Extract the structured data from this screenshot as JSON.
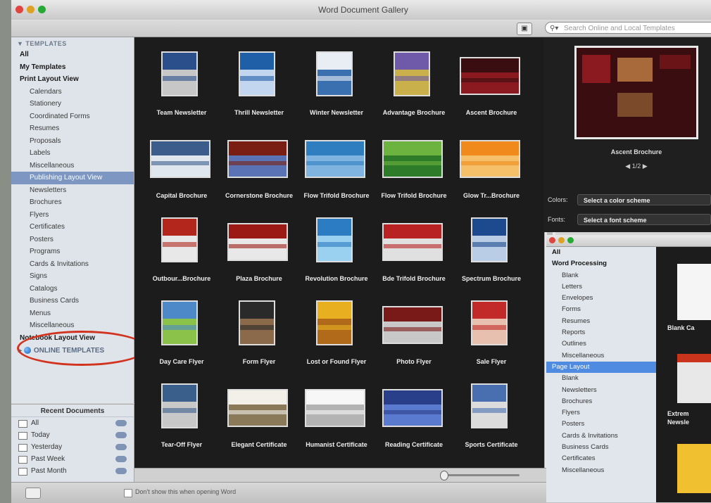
{
  "window": {
    "title": "Word Document Gallery"
  },
  "search": {
    "placeholder": "Search Online and Local Templates"
  },
  "sidebar": {
    "header": "TEMPLATES",
    "items": [
      {
        "label": "All",
        "style": "bold"
      },
      {
        "label": "My Templates",
        "style": "bold"
      },
      {
        "label": "Print Layout View",
        "style": "bold"
      },
      {
        "label": "Calendars",
        "style": "sub"
      },
      {
        "label": "Stationery",
        "style": "sub"
      },
      {
        "label": "Coordinated Forms",
        "style": "sub"
      },
      {
        "label": "Resumes",
        "style": "sub"
      },
      {
        "label": "Proposals",
        "style": "sub"
      },
      {
        "label": "Labels",
        "style": "sub"
      },
      {
        "label": "Miscellaneous",
        "style": "sub"
      },
      {
        "label": "Publishing Layout View",
        "style": "sel"
      },
      {
        "label": "Newsletters",
        "style": "sub"
      },
      {
        "label": "Brochures",
        "style": "sub"
      },
      {
        "label": "Flyers",
        "style": "sub"
      },
      {
        "label": "Certificates",
        "style": "sub"
      },
      {
        "label": "Posters",
        "style": "sub"
      },
      {
        "label": "Programs",
        "style": "sub"
      },
      {
        "label": "Cards & Invitations",
        "style": "sub"
      },
      {
        "label": "Signs",
        "style": "sub"
      },
      {
        "label": "Catalogs",
        "style": "sub"
      },
      {
        "label": "Business Cards",
        "style": "sub"
      },
      {
        "label": "Menus",
        "style": "sub"
      },
      {
        "label": "Miscellaneous",
        "style": "sub"
      },
      {
        "label": "Notebook Layout View",
        "style": "bold"
      }
    ],
    "online": "ONLINE TEMPLATES"
  },
  "recent": {
    "header": "Recent Documents",
    "items": [
      "All",
      "Today",
      "Yesterday",
      "Past Week",
      "Past Month"
    ]
  },
  "gallery": {
    "templates": [
      {
        "label": "Team Newsletter",
        "c1": "#2a4f8a",
        "c2": "#c7c7c7",
        "wide": false
      },
      {
        "label": "Thrill Newsletter",
        "c1": "#1f5fa8",
        "c2": "#c2d6ef",
        "wide": false
      },
      {
        "label": "Winter Newsletter",
        "c1": "#e9eef5",
        "c2": "#3a6fb0",
        "wide": false
      },
      {
        "label": "Advantage Brochure",
        "c1": "#6e5aa8",
        "c2": "#c9b04a",
        "wide": false
      },
      {
        "label": "Ascent Brochure",
        "c1": "#3a0d10",
        "c2": "#8a1a20",
        "wide": true
      },
      {
        "label": "Capital Brochure",
        "c1": "#3c5d8c",
        "c2": "#dfe6ee",
        "wide": true
      },
      {
        "label": "Cornerstone Brochure",
        "c1": "#7a1e14",
        "c2": "#5a73b5",
        "wide": true
      },
      {
        "label": "Flow Trifold Brochure",
        "c1": "#2f7ec0",
        "c2": "#7fb4e0",
        "wide": true
      },
      {
        "label": "Flow Trifold Brochure",
        "c1": "#6cb33f",
        "c2": "#2e7b2a",
        "wide": true
      },
      {
        "label": "Glow Tr...Brochure",
        "c1": "#f08a1c",
        "c2": "#f6c06a",
        "wide": true
      },
      {
        "label": "Outbour...Brochure",
        "c1": "#b2261c",
        "c2": "#e8e8e8",
        "wide": false
      },
      {
        "label": "Plaza Brochure",
        "c1": "#9c1a16",
        "c2": "#e8e8e8",
        "wide": true
      },
      {
        "label": "Revolution Brochure",
        "c1": "#2b7cc2",
        "c2": "#9ad0f0",
        "wide": false
      },
      {
        "label": "Bde Trifold Brochure",
        "c1": "#b82222",
        "c2": "#e0e0e0",
        "wide": true
      },
      {
        "label": "Spectrum Brochure",
        "c1": "#1d4a8e",
        "c2": "#b9cde6",
        "wide": false
      },
      {
        "label": "Day Care Flyer",
        "c1": "#4d89c8",
        "c2": "#8bc34a",
        "wide": false
      },
      {
        "label": "Form Flyer",
        "c1": "#2a2a2a",
        "c2": "#8a6a4a",
        "wide": false
      },
      {
        "label": "Lost or Found Flyer",
        "c1": "#e8b020",
        "c2": "#b06a1a",
        "wide": false
      },
      {
        "label": "Photo Flyer",
        "c1": "#7a1a18",
        "c2": "#c8c8c8",
        "wide": true
      },
      {
        "label": "Sale Flyer",
        "c1": "#c22a2a",
        "c2": "#e8c0b0",
        "wide": false
      },
      {
        "label": "Tear-Off Flyer",
        "c1": "#3a5f8a",
        "c2": "#c8c8c8",
        "wide": false
      },
      {
        "label": "Elegant Certificate",
        "c1": "#f2f0e8",
        "c2": "#8a7a5a",
        "wide": true
      },
      {
        "label": "Humanist Certificate",
        "c1": "#f7f7f7",
        "c2": "#b3b3b3",
        "wide": true
      },
      {
        "label": "Reading Certificate",
        "c1": "#2a3f8a",
        "c2": "#5a7ad0",
        "wide": true
      },
      {
        "label": "Sports Certificate",
        "c1": "#4a6fb0",
        "c2": "#dcdcdc",
        "wide": false
      }
    ]
  },
  "preview": {
    "caption": "Ascent Brochure",
    "page": "1/2",
    "colors_label": "Colors:",
    "colors_value": "Select a color scheme",
    "fonts_label": "Fonts:",
    "fonts_value": "Select a font scheme"
  },
  "bottom": {
    "checkbox_label": "Don't show this when opening Word"
  },
  "second_window": {
    "items": [
      {
        "label": "All",
        "style": "bold"
      },
      {
        "label": "Word Processing",
        "style": "bold"
      },
      {
        "label": "Blank",
        "style": "sub"
      },
      {
        "label": "Letters",
        "style": "sub"
      },
      {
        "label": "Envelopes",
        "style": "sub"
      },
      {
        "label": "Forms",
        "style": "sub"
      },
      {
        "label": "Resumes",
        "style": "sub"
      },
      {
        "label": "Reports",
        "style": "sub"
      },
      {
        "label": "Outlines",
        "style": "sub"
      },
      {
        "label": "Miscellaneous",
        "style": "sub"
      },
      {
        "label": "Page Layout",
        "style": "sel"
      },
      {
        "label": "Blank",
        "style": "sub"
      },
      {
        "label": "Newsletters",
        "style": "sub"
      },
      {
        "label": "Brochures",
        "style": "sub"
      },
      {
        "label": "Flyers",
        "style": "sub"
      },
      {
        "label": "Posters",
        "style": "sub"
      },
      {
        "label": "Cards & Invitations",
        "style": "sub"
      },
      {
        "label": "Business Cards",
        "style": "sub"
      },
      {
        "label": "Certificates",
        "style": "sub"
      },
      {
        "label": "Miscellaneous",
        "style": "sub"
      }
    ],
    "captions": [
      "Blank Ca",
      "Extrem",
      "Newsle"
    ]
  }
}
